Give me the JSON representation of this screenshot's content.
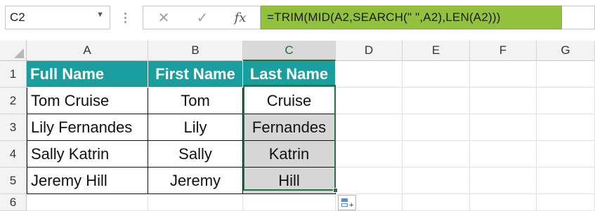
{
  "name_box": {
    "value": "C2"
  },
  "formula_bar": {
    "cancel_icon": "cancel-x-icon",
    "enter_icon": "checkmark-icon",
    "fx_label": "fx",
    "formula": "=TRIM(MID(A2,SEARCH(\" \",A2),LEN(A2)))",
    "formula_highlight_color": "#92c13e"
  },
  "columns": [
    "A",
    "B",
    "C",
    "D",
    "E",
    "F",
    "G"
  ],
  "selected_column": "C",
  "rows": [
    "1",
    "2",
    "3",
    "4",
    "5",
    "6"
  ],
  "table": {
    "header_color": "#1a9e9e",
    "headers": [
      "Full Name",
      "First Name",
      "Last Name"
    ],
    "body": [
      [
        "Tom Cruise",
        "Tom",
        "Cruise"
      ],
      [
        "Lily Fernandes",
        "Lily",
        "Fernandes"
      ],
      [
        "Sally Katrin",
        "Sally",
        "Katrin"
      ],
      [
        "Jeremy Hill",
        "Jeremy",
        "Hill"
      ]
    ]
  },
  "selection": {
    "active_cell": "C2",
    "range": "C2:C5",
    "border_color": "#217346"
  },
  "quick_analysis": {
    "icon": "quick-analysis-icon"
  }
}
